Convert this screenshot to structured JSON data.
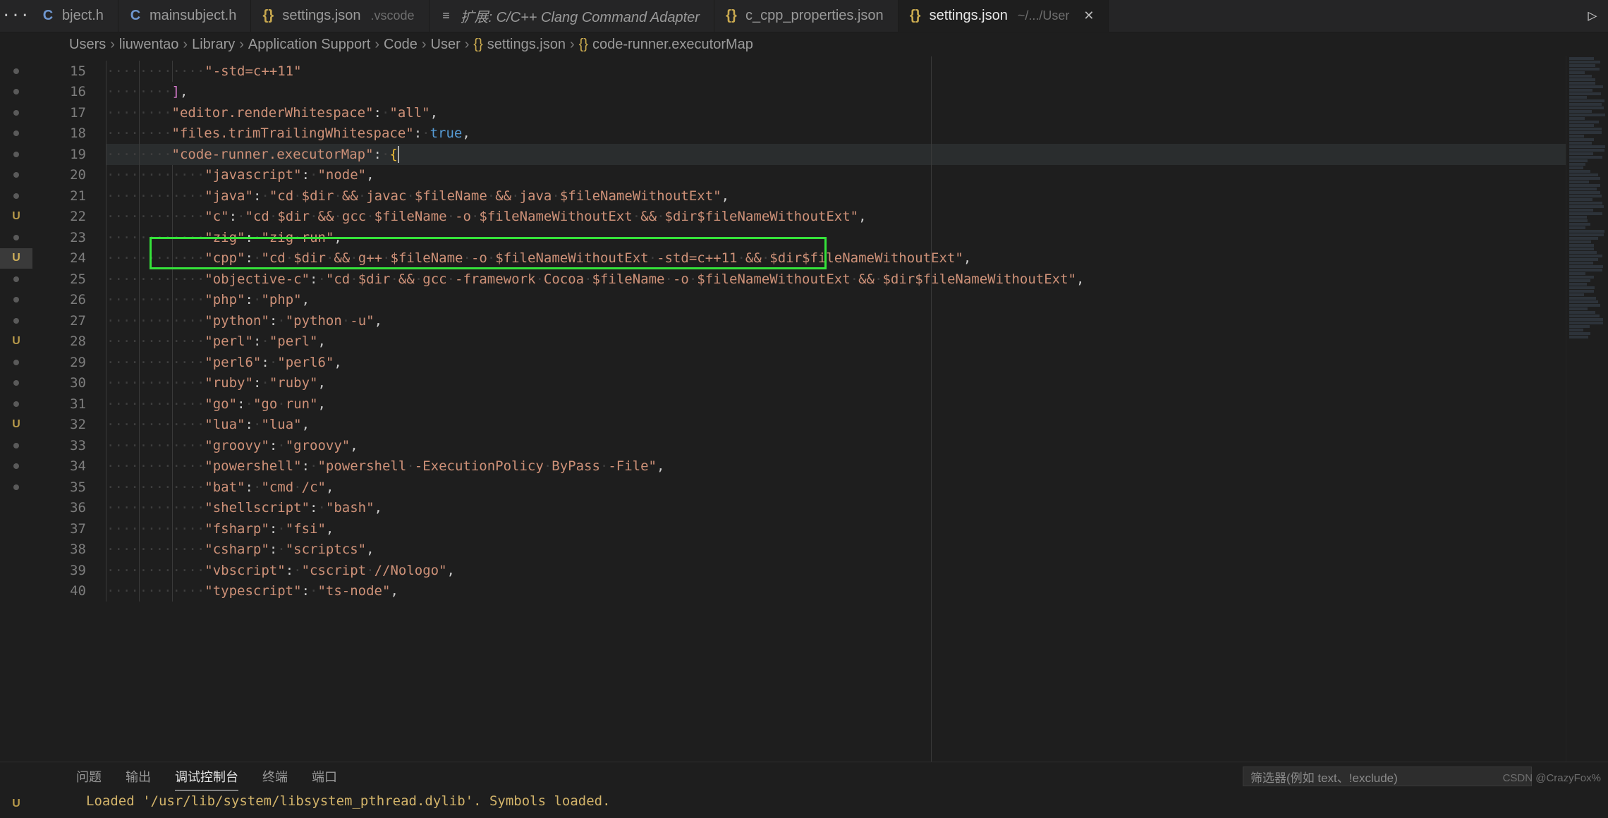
{
  "tabs": {
    "more": "···",
    "list": [
      {
        "icon": "C",
        "iconClass": "ico-c",
        "label": "bject.h",
        "detail": "",
        "italic": false
      },
      {
        "icon": "C",
        "iconClass": "ico-c",
        "label": "mainsubject.h",
        "detail": "",
        "italic": false
      },
      {
        "icon": "{}",
        "iconClass": "ico-brace",
        "label": "settings.json",
        "detail": ".vscode",
        "italic": false
      },
      {
        "icon": "≡",
        "iconClass": "ico-ext",
        "label": "扩展: C/C++ Clang Command Adapter",
        "detail": "",
        "italic": true
      },
      {
        "icon": "{}",
        "iconClass": "ico-brace",
        "label": "c_cpp_properties.json",
        "detail": "",
        "italic": false
      },
      {
        "icon": "{}",
        "iconClass": "ico-brace",
        "label": "settings.json",
        "detail": "~/.../User",
        "italic": false,
        "active": true,
        "close": "✕"
      }
    ],
    "run": "▷"
  },
  "breadcrumbs": {
    "parts": [
      "Users",
      "liuwentao",
      "Library",
      "Application Support",
      "Code",
      "User"
    ],
    "fileIcon": "{}",
    "file": "settings.json",
    "symbolIcon": "{}",
    "symbol": "code-runner.executorMap",
    "chev": "›"
  },
  "scm": [
    {
      "t": "dot"
    },
    {
      "t": "dot"
    },
    {
      "t": "dot"
    },
    {
      "t": "dot"
    },
    {
      "t": "dot"
    },
    {
      "t": "dot"
    },
    {
      "t": "dot"
    },
    {
      "t": "lbl",
      "v": "U"
    },
    {
      "t": "dot"
    },
    {
      "t": "lbl",
      "v": "U",
      "sel": true
    },
    {
      "t": "dot"
    },
    {
      "t": "dot"
    },
    {
      "t": "dot"
    },
    {
      "t": "lbl",
      "v": "U"
    },
    {
      "t": "dot"
    },
    {
      "t": "dot"
    },
    {
      "t": "dot"
    },
    {
      "t": "lbl",
      "v": "U"
    },
    {
      "t": "dot"
    },
    {
      "t": "dot"
    },
    {
      "t": "dot"
    }
  ],
  "gutter": {
    "start": 15,
    "count": 26
  },
  "code": {
    "indentGlyph": "·",
    "lines": [
      {
        "n": 15,
        "ind": 3,
        "seg": [
          {
            "c": "tok-str",
            "t": "\"-std=c++11\""
          }
        ]
      },
      {
        "n": 16,
        "ind": 2,
        "seg": [
          {
            "c": "tok-brack",
            "t": "]"
          },
          {
            "c": "tok-punc",
            "t": ","
          }
        ]
      },
      {
        "n": 17,
        "ind": 2,
        "seg": [
          {
            "c": "tok-key",
            "t": "\"editor.renderWhitespace\""
          },
          {
            "c": "tok-colon",
            "t": ":"
          },
          {
            "c": "ws",
            "t": "·"
          },
          {
            "c": "tok-str",
            "t": "\"all\""
          },
          {
            "c": "tok-punc",
            "t": ","
          }
        ]
      },
      {
        "n": 18,
        "ind": 2,
        "seg": [
          {
            "c": "tok-key",
            "t": "\"files.trimTrailingWhitespace\""
          },
          {
            "c": "tok-colon",
            "t": ":"
          },
          {
            "c": "ws",
            "t": "·"
          },
          {
            "c": "tok-bool",
            "t": "true"
          },
          {
            "c": "tok-punc",
            "t": ","
          }
        ]
      },
      {
        "n": 19,
        "ind": 2,
        "cur": true,
        "seg": [
          {
            "c": "tok-key",
            "t": "\"code-runner.executorMap\""
          },
          {
            "c": "tok-colon",
            "t": ":"
          },
          {
            "c": "ws",
            "t": "·"
          },
          {
            "c": "tok-brace",
            "t": "{"
          },
          {
            "c": "cursor",
            "t": ""
          }
        ]
      },
      {
        "n": 20,
        "ind": 3,
        "seg": [
          {
            "c": "tok-key",
            "t": "\"javascript\""
          },
          {
            "c": "tok-colon",
            "t": ":"
          },
          {
            "c": "ws",
            "t": "·"
          },
          {
            "c": "tok-str",
            "t": "\"node\""
          },
          {
            "c": "tok-punc",
            "t": ","
          }
        ]
      },
      {
        "n": 21,
        "ind": 3,
        "seg": [
          {
            "c": "tok-key",
            "t": "\"java\""
          },
          {
            "c": "tok-colon",
            "t": ":"
          },
          {
            "c": "ws",
            "t": "·"
          },
          {
            "c": "tok-str",
            "t": "\"cd·$dir·&&·javac·$fileName·&&·java·$fileNameWithoutExt\""
          },
          {
            "c": "tok-punc",
            "t": ","
          }
        ]
      },
      {
        "n": 22,
        "ind": 3,
        "seg": [
          {
            "c": "tok-key",
            "t": "\"c\""
          },
          {
            "c": "tok-colon",
            "t": ":"
          },
          {
            "c": "ws",
            "t": "·"
          },
          {
            "c": "tok-str",
            "t": "\"cd·$dir·&&·gcc·$fileName·-o·$fileNameWithoutExt·&&·$dir$fileNameWithoutExt\""
          },
          {
            "c": "tok-punc",
            "t": ","
          }
        ]
      },
      {
        "n": 23,
        "ind": 3,
        "seg": [
          {
            "c": "tok-key",
            "t": "\"zig\""
          },
          {
            "c": "tok-colon",
            "t": ":"
          },
          {
            "c": "ws",
            "t": "·"
          },
          {
            "c": "tok-str",
            "t": "\"zig·run\""
          },
          {
            "c": "tok-punc",
            "t": ","
          }
        ]
      },
      {
        "n": 24,
        "ind": 3,
        "hl": true,
        "seg": [
          {
            "c": "tok-key",
            "t": "\"cpp\""
          },
          {
            "c": "tok-colon",
            "t": ":"
          },
          {
            "c": "ws",
            "t": "·"
          },
          {
            "c": "tok-str",
            "t": "\"cd·$dir·&&·g++·$fileName·-o·$fileNameWithoutExt·-std=c++11·&&·$dir$fileNameWithoutExt\""
          },
          {
            "c": "tok-punc",
            "t": ","
          }
        ]
      },
      {
        "n": 25,
        "ind": 3,
        "seg": [
          {
            "c": "tok-key",
            "t": "\"objective-c\""
          },
          {
            "c": "tok-colon",
            "t": ":"
          },
          {
            "c": "ws",
            "t": "·"
          },
          {
            "c": "tok-str",
            "t": "\"cd·$dir·&&·gcc·-framework·Cocoa·$fileName·-o·$fileNameWithoutExt·&&·$dir$fileNameWithoutExt\""
          },
          {
            "c": "tok-punc",
            "t": ","
          }
        ]
      },
      {
        "n": 26,
        "ind": 3,
        "seg": [
          {
            "c": "tok-key",
            "t": "\"php\""
          },
          {
            "c": "tok-colon",
            "t": ":"
          },
          {
            "c": "ws",
            "t": "·"
          },
          {
            "c": "tok-str",
            "t": "\"php\""
          },
          {
            "c": "tok-punc",
            "t": ","
          }
        ]
      },
      {
        "n": 27,
        "ind": 3,
        "seg": [
          {
            "c": "tok-key",
            "t": "\"python\""
          },
          {
            "c": "tok-colon",
            "t": ":"
          },
          {
            "c": "ws",
            "t": "·"
          },
          {
            "c": "tok-str",
            "t": "\"python·-u\""
          },
          {
            "c": "tok-punc",
            "t": ","
          }
        ]
      },
      {
        "n": 28,
        "ind": 3,
        "seg": [
          {
            "c": "tok-key",
            "t": "\"perl\""
          },
          {
            "c": "tok-colon",
            "t": ":"
          },
          {
            "c": "ws",
            "t": "·"
          },
          {
            "c": "tok-str",
            "t": "\"perl\""
          },
          {
            "c": "tok-punc",
            "t": ","
          }
        ]
      },
      {
        "n": 29,
        "ind": 3,
        "seg": [
          {
            "c": "tok-key",
            "t": "\"perl6\""
          },
          {
            "c": "tok-colon",
            "t": ":"
          },
          {
            "c": "ws",
            "t": "·"
          },
          {
            "c": "tok-str",
            "t": "\"perl6\""
          },
          {
            "c": "tok-punc",
            "t": ","
          }
        ]
      },
      {
        "n": 30,
        "ind": 3,
        "seg": [
          {
            "c": "tok-key",
            "t": "\"ruby\""
          },
          {
            "c": "tok-colon",
            "t": ":"
          },
          {
            "c": "ws",
            "t": "·"
          },
          {
            "c": "tok-str",
            "t": "\"ruby\""
          },
          {
            "c": "tok-punc",
            "t": ","
          }
        ]
      },
      {
        "n": 31,
        "ind": 3,
        "seg": [
          {
            "c": "tok-key",
            "t": "\"go\""
          },
          {
            "c": "tok-colon",
            "t": ":"
          },
          {
            "c": "ws",
            "t": "·"
          },
          {
            "c": "tok-str",
            "t": "\"go·run\""
          },
          {
            "c": "tok-punc",
            "t": ","
          }
        ]
      },
      {
        "n": 32,
        "ind": 3,
        "seg": [
          {
            "c": "tok-key",
            "t": "\"lua\""
          },
          {
            "c": "tok-colon",
            "t": ":"
          },
          {
            "c": "ws",
            "t": "·"
          },
          {
            "c": "tok-str",
            "t": "\"lua\""
          },
          {
            "c": "tok-punc",
            "t": ","
          }
        ]
      },
      {
        "n": 33,
        "ind": 3,
        "seg": [
          {
            "c": "tok-key",
            "t": "\"groovy\""
          },
          {
            "c": "tok-colon",
            "t": ":"
          },
          {
            "c": "ws",
            "t": "·"
          },
          {
            "c": "tok-str",
            "t": "\"groovy\""
          },
          {
            "c": "tok-punc",
            "t": ","
          }
        ]
      },
      {
        "n": 34,
        "ind": 3,
        "seg": [
          {
            "c": "tok-key",
            "t": "\"powershell\""
          },
          {
            "c": "tok-colon",
            "t": ":"
          },
          {
            "c": "ws",
            "t": "·"
          },
          {
            "c": "tok-str",
            "t": "\"powershell·-ExecutionPolicy·ByPass·-File\""
          },
          {
            "c": "tok-punc",
            "t": ","
          }
        ]
      },
      {
        "n": 35,
        "ind": 3,
        "seg": [
          {
            "c": "tok-key",
            "t": "\"bat\""
          },
          {
            "c": "tok-colon",
            "t": ":"
          },
          {
            "c": "ws",
            "t": "·"
          },
          {
            "c": "tok-str",
            "t": "\"cmd·/c\""
          },
          {
            "c": "tok-punc",
            "t": ","
          }
        ]
      },
      {
        "n": 36,
        "ind": 3,
        "seg": [
          {
            "c": "tok-key",
            "t": "\"shellscript\""
          },
          {
            "c": "tok-colon",
            "t": ":"
          },
          {
            "c": "ws",
            "t": "·"
          },
          {
            "c": "tok-str",
            "t": "\"bash\""
          },
          {
            "c": "tok-punc",
            "t": ","
          }
        ]
      },
      {
        "n": 37,
        "ind": 3,
        "seg": [
          {
            "c": "tok-key",
            "t": "\"fsharp\""
          },
          {
            "c": "tok-colon",
            "t": ":"
          },
          {
            "c": "ws",
            "t": "·"
          },
          {
            "c": "tok-str",
            "t": "\"fsi\""
          },
          {
            "c": "tok-punc",
            "t": ","
          }
        ]
      },
      {
        "n": 38,
        "ind": 3,
        "seg": [
          {
            "c": "tok-key",
            "t": "\"csharp\""
          },
          {
            "c": "tok-colon",
            "t": ":"
          },
          {
            "c": "ws",
            "t": "·"
          },
          {
            "c": "tok-str",
            "t": "\"scriptcs\""
          },
          {
            "c": "tok-punc",
            "t": ","
          }
        ]
      },
      {
        "n": 39,
        "ind": 3,
        "seg": [
          {
            "c": "tok-key",
            "t": "\"vbscript\""
          },
          {
            "c": "tok-colon",
            "t": ":"
          },
          {
            "c": "ws",
            "t": "·"
          },
          {
            "c": "tok-str",
            "t": "\"cscript·//Nologo\""
          },
          {
            "c": "tok-punc",
            "t": ","
          }
        ]
      },
      {
        "n": 40,
        "ind": 3,
        "seg": [
          {
            "c": "tok-key",
            "t": "\"typescript\""
          },
          {
            "c": "tok-colon",
            "t": ":"
          },
          {
            "c": "ws",
            "t": "·"
          },
          {
            "c": "tok-str",
            "t": "\"ts-node\""
          },
          {
            "c": "tok-punc",
            "t": ","
          }
        ]
      }
    ]
  },
  "panel": {
    "tabs": [
      "问题",
      "输出",
      "调试控制台",
      "终端",
      "端口"
    ],
    "active": 2,
    "filterPlaceholder": "筛选器(例如 text、!exclude)",
    "output": "Loaded '/usr/lib/system/libsystem_pthread.dylib'. Symbols loaded."
  },
  "watermark": "CSDN @CrazyFox%",
  "scmBottom": {
    "t": "lbl",
    "v": "U"
  }
}
